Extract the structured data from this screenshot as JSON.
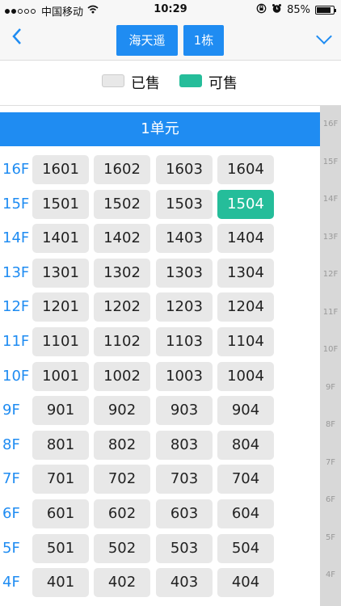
{
  "status_bar": {
    "carrier": "中国移动",
    "time": "10:29",
    "battery": "85%"
  },
  "nav": {
    "project": "海天遥",
    "building": "1栋"
  },
  "legend": {
    "sold": "已售",
    "available": "可售"
  },
  "unit_title": "1单元",
  "side_index": [
    "16F",
    "15F",
    "14F",
    "13F",
    "12F",
    "11F",
    "10F",
    "9F",
    "8F",
    "7F",
    "6F",
    "5F",
    "4F"
  ],
  "floors": [
    {
      "label": "16F",
      "rooms": [
        {
          "no": "1601",
          "status": "sold"
        },
        {
          "no": "1602",
          "status": "sold"
        },
        {
          "no": "1603",
          "status": "sold"
        },
        {
          "no": "1604",
          "status": "sold"
        }
      ]
    },
    {
      "label": "15F",
      "rooms": [
        {
          "no": "1501",
          "status": "sold"
        },
        {
          "no": "1502",
          "status": "sold"
        },
        {
          "no": "1503",
          "status": "sold"
        },
        {
          "no": "1504",
          "status": "available"
        }
      ]
    },
    {
      "label": "14F",
      "rooms": [
        {
          "no": "1401",
          "status": "sold"
        },
        {
          "no": "1402",
          "status": "sold"
        },
        {
          "no": "1403",
          "status": "sold"
        },
        {
          "no": "1404",
          "status": "sold"
        }
      ]
    },
    {
      "label": "13F",
      "rooms": [
        {
          "no": "1301",
          "status": "sold"
        },
        {
          "no": "1302",
          "status": "sold"
        },
        {
          "no": "1303",
          "status": "sold"
        },
        {
          "no": "1304",
          "status": "sold"
        }
      ]
    },
    {
      "label": "12F",
      "rooms": [
        {
          "no": "1201",
          "status": "sold"
        },
        {
          "no": "1202",
          "status": "sold"
        },
        {
          "no": "1203",
          "status": "sold"
        },
        {
          "no": "1204",
          "status": "sold"
        }
      ]
    },
    {
      "label": "11F",
      "rooms": [
        {
          "no": "1101",
          "status": "sold"
        },
        {
          "no": "1102",
          "status": "sold"
        },
        {
          "no": "1103",
          "status": "sold"
        },
        {
          "no": "1104",
          "status": "sold"
        }
      ]
    },
    {
      "label": "10F",
      "rooms": [
        {
          "no": "1001",
          "status": "sold"
        },
        {
          "no": "1002",
          "status": "sold"
        },
        {
          "no": "1003",
          "status": "sold"
        },
        {
          "no": "1004",
          "status": "sold"
        }
      ]
    },
    {
      "label": "9F",
      "rooms": [
        {
          "no": "901",
          "status": "sold"
        },
        {
          "no": "902",
          "status": "sold"
        },
        {
          "no": "903",
          "status": "sold"
        },
        {
          "no": "904",
          "status": "sold"
        }
      ]
    },
    {
      "label": "8F",
      "rooms": [
        {
          "no": "801",
          "status": "sold"
        },
        {
          "no": "802",
          "status": "sold"
        },
        {
          "no": "803",
          "status": "sold"
        },
        {
          "no": "804",
          "status": "sold"
        }
      ]
    },
    {
      "label": "7F",
      "rooms": [
        {
          "no": "701",
          "status": "sold"
        },
        {
          "no": "702",
          "status": "sold"
        },
        {
          "no": "703",
          "status": "sold"
        },
        {
          "no": "704",
          "status": "sold"
        }
      ]
    },
    {
      "label": "6F",
      "rooms": [
        {
          "no": "601",
          "status": "sold"
        },
        {
          "no": "602",
          "status": "sold"
        },
        {
          "no": "603",
          "status": "sold"
        },
        {
          "no": "604",
          "status": "sold"
        }
      ]
    },
    {
      "label": "5F",
      "rooms": [
        {
          "no": "501",
          "status": "sold"
        },
        {
          "no": "502",
          "status": "sold"
        },
        {
          "no": "503",
          "status": "sold"
        },
        {
          "no": "504",
          "status": "sold"
        }
      ]
    },
    {
      "label": "4F",
      "rooms": [
        {
          "no": "401",
          "status": "sold"
        },
        {
          "no": "402",
          "status": "sold"
        },
        {
          "no": "403",
          "status": "sold"
        },
        {
          "no": "404",
          "status": "sold"
        }
      ]
    }
  ],
  "colors": {
    "accent": "#1f8cf2",
    "sold": "#e8e8e8",
    "available": "#25bd9a"
  }
}
